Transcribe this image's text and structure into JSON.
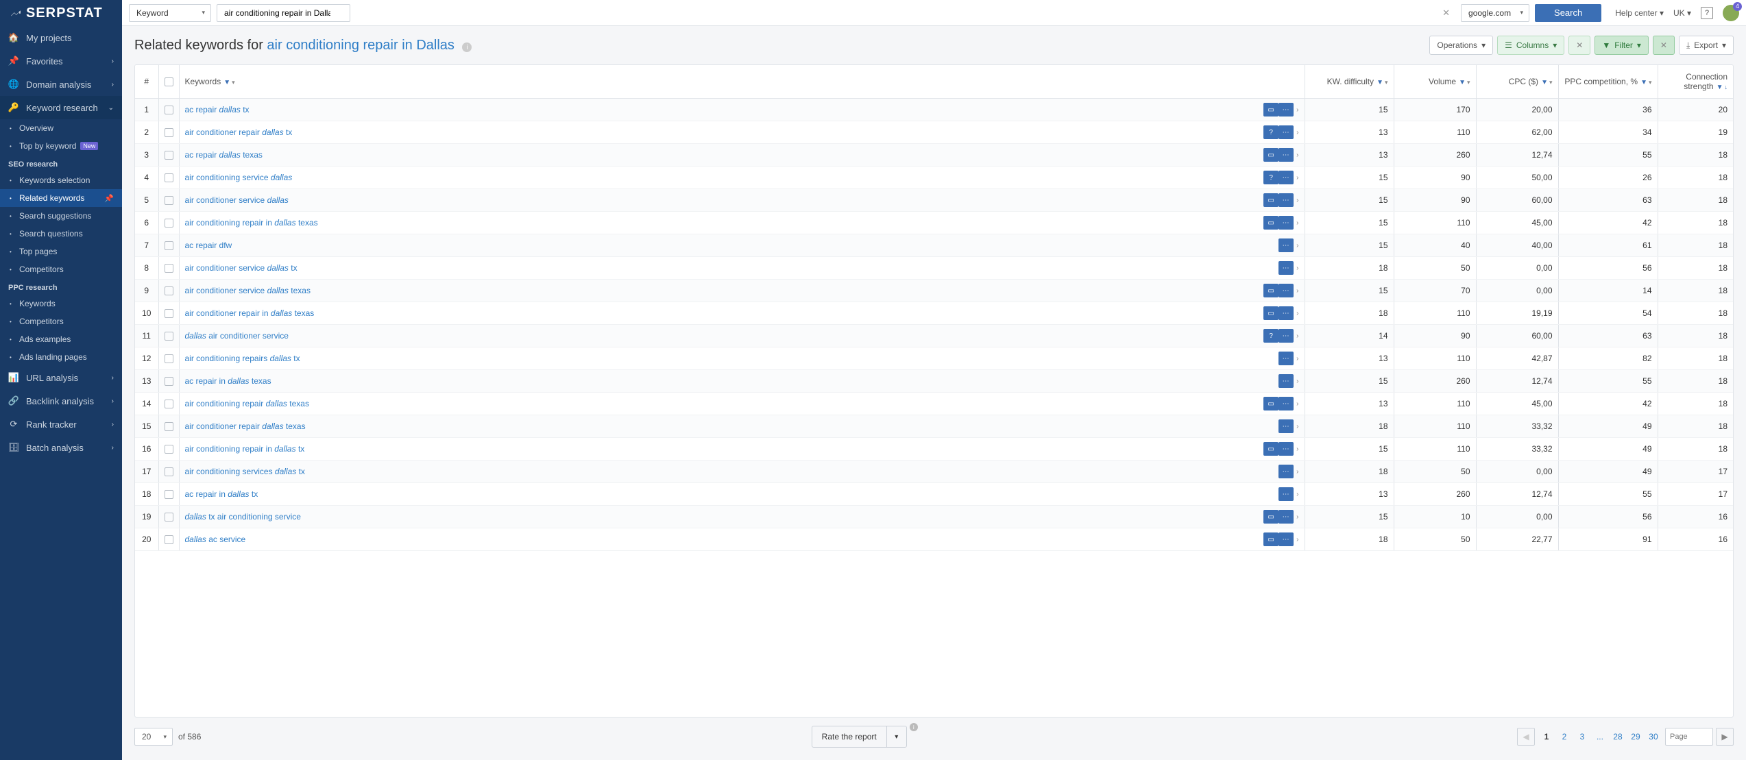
{
  "logo": "SERPSTAT",
  "topbar": {
    "mode": "Keyword",
    "query": "air conditioning repair in Dallas",
    "engine": "google.com",
    "search_btn": "Search",
    "help": "Help center",
    "locale": "UK",
    "notif_count": "4"
  },
  "sidebar": {
    "my_projects": "My projects",
    "favorites": "Favorites",
    "domain_analysis": "Domain analysis",
    "keyword_research": "Keyword research",
    "overview": "Overview",
    "top_by_keyword": "Top by keyword",
    "new_badge": "New",
    "seo_research": "SEO research",
    "keywords_selection": "Keywords selection",
    "related_keywords": "Related keywords",
    "search_suggestions": "Search suggestions",
    "search_questions": "Search questions",
    "top_pages": "Top pages",
    "competitors": "Competitors",
    "ppc_research": "PPC research",
    "keywords": "Keywords",
    "competitors2": "Competitors",
    "ads_examples": "Ads examples",
    "ads_landing": "Ads landing pages",
    "url_analysis": "URL analysis",
    "backlink_analysis": "Backlink analysis",
    "rank_tracker": "Rank tracker",
    "batch_analysis": "Batch analysis"
  },
  "header": {
    "prefix": "Related keywords for ",
    "kw": "air conditioning repair in Dallas",
    "operations": "Operations",
    "columns": "Columns",
    "filter": "Filter",
    "export": "Export"
  },
  "columns": {
    "num": "#",
    "keywords": "Keywords",
    "kwdiff": "KW. difficulty",
    "volume": "Volume",
    "cpc": "CPC ($)",
    "ppc": "PPC competition, %",
    "conn": "Connection strength"
  },
  "rows": [
    {
      "n": 1,
      "pre": "ac repair ",
      "em": "dallas",
      "post": " tx",
      "icons": [
        "bar",
        "dots"
      ],
      "kd": "15",
      "vol": "170",
      "cpc": "20,00",
      "ppc": "36",
      "conn": "20"
    },
    {
      "n": 2,
      "pre": "air conditioner repair ",
      "em": "dallas",
      "post": " tx",
      "icons": [
        "q",
        "dots"
      ],
      "kd": "13",
      "vol": "110",
      "cpc": "62,00",
      "ppc": "34",
      "conn": "19"
    },
    {
      "n": 3,
      "pre": "ac repair ",
      "em": "dallas",
      "post": " texas",
      "icons": [
        "bar",
        "dots"
      ],
      "kd": "13",
      "vol": "260",
      "cpc": "12,74",
      "ppc": "55",
      "conn": "18"
    },
    {
      "n": 4,
      "pre": "air conditioning service ",
      "em": "dallas",
      "post": "",
      "icons": [
        "q",
        "dots"
      ],
      "kd": "15",
      "vol": "90",
      "cpc": "50,00",
      "ppc": "26",
      "conn": "18"
    },
    {
      "n": 5,
      "pre": "air conditioner service ",
      "em": "dallas",
      "post": "",
      "icons": [
        "bar",
        "dots"
      ],
      "kd": "15",
      "vol": "90",
      "cpc": "60,00",
      "ppc": "63",
      "conn": "18"
    },
    {
      "n": 6,
      "pre": "air conditioning repair in ",
      "em": "dallas",
      "post": " texas",
      "icons": [
        "bar",
        "dots"
      ],
      "kd": "15",
      "vol": "110",
      "cpc": "45,00",
      "ppc": "42",
      "conn": "18"
    },
    {
      "n": 7,
      "pre": "ac repair dfw",
      "em": "",
      "post": "",
      "icons": [
        "dots"
      ],
      "kd": "15",
      "vol": "40",
      "cpc": "40,00",
      "ppc": "61",
      "conn": "18"
    },
    {
      "n": 8,
      "pre": "air conditioner service ",
      "em": "dallas",
      "post": " tx",
      "icons": [
        "dots"
      ],
      "kd": "18",
      "vol": "50",
      "cpc": "0,00",
      "ppc": "56",
      "conn": "18"
    },
    {
      "n": 9,
      "pre": "air conditioner service ",
      "em": "dallas",
      "post": " texas",
      "icons": [
        "bar",
        "dots"
      ],
      "kd": "15",
      "vol": "70",
      "cpc": "0,00",
      "ppc": "14",
      "conn": "18"
    },
    {
      "n": 10,
      "pre": "air conditioner repair in ",
      "em": "dallas",
      "post": " texas",
      "icons": [
        "bar",
        "dots"
      ],
      "kd": "18",
      "vol": "110",
      "cpc": "19,19",
      "ppc": "54",
      "conn": "18"
    },
    {
      "n": 11,
      "pre": "",
      "em": "dallas",
      "post": " air conditioner service",
      "icons": [
        "q",
        "dots"
      ],
      "kd": "14",
      "vol": "90",
      "cpc": "60,00",
      "ppc": "63",
      "conn": "18"
    },
    {
      "n": 12,
      "pre": "air conditioning repairs ",
      "em": "dallas",
      "post": " tx",
      "icons": [
        "dots"
      ],
      "kd": "13",
      "vol": "110",
      "cpc": "42,87",
      "ppc": "82",
      "conn": "18"
    },
    {
      "n": 13,
      "pre": "ac repair in ",
      "em": "dallas",
      "post": " texas",
      "icons": [
        "dots"
      ],
      "kd": "15",
      "vol": "260",
      "cpc": "12,74",
      "ppc": "55",
      "conn": "18"
    },
    {
      "n": 14,
      "pre": "air conditioning repair ",
      "em": "dallas",
      "post": " texas",
      "icons": [
        "bar",
        "dots"
      ],
      "kd": "13",
      "vol": "110",
      "cpc": "45,00",
      "ppc": "42",
      "conn": "18"
    },
    {
      "n": 15,
      "pre": "air conditioner repair ",
      "em": "dallas",
      "post": " texas",
      "icons": [
        "dots"
      ],
      "kd": "18",
      "vol": "110",
      "cpc": "33,32",
      "ppc": "49",
      "conn": "18"
    },
    {
      "n": 16,
      "pre": "air conditioning repair in ",
      "em": "dallas",
      "post": " tx",
      "icons": [
        "bar",
        "dots"
      ],
      "kd": "15",
      "vol": "110",
      "cpc": "33,32",
      "ppc": "49",
      "conn": "18"
    },
    {
      "n": 17,
      "pre": "air conditioning services ",
      "em": "dallas",
      "post": " tx",
      "icons": [
        "dots"
      ],
      "kd": "18",
      "vol": "50",
      "cpc": "0,00",
      "ppc": "49",
      "conn": "17"
    },
    {
      "n": 18,
      "pre": "ac repair in ",
      "em": "dallas",
      "post": " tx",
      "icons": [
        "dots"
      ],
      "kd": "13",
      "vol": "260",
      "cpc": "12,74",
      "ppc": "55",
      "conn": "17"
    },
    {
      "n": 19,
      "pre": "",
      "em": "dallas",
      "post": " tx air conditioning service",
      "icons": [
        "bar",
        "dots"
      ],
      "kd": "15",
      "vol": "10",
      "cpc": "0,00",
      "ppc": "56",
      "conn": "16"
    },
    {
      "n": 20,
      "pre": "",
      "em": "dallas",
      "post": " ac service",
      "icons": [
        "bar",
        "dots"
      ],
      "kd": "18",
      "vol": "50",
      "cpc": "22,77",
      "ppc": "91",
      "conn": "16"
    }
  ],
  "footer": {
    "per_page": "20",
    "of_total": "of 586",
    "rate": "Rate the report",
    "pages": [
      "1",
      "2",
      "3",
      "...",
      "28",
      "29",
      "30"
    ],
    "page_placeholder": "Page"
  }
}
